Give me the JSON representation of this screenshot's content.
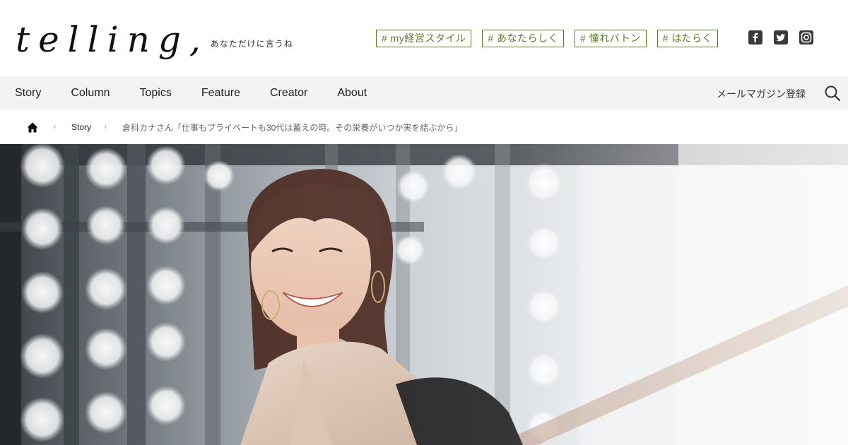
{
  "brand": {
    "logo": "telling,",
    "tagline": "あなただけに言うね"
  },
  "tags": [
    {
      "label": "# my経営スタイル"
    },
    {
      "label": "# あなたらしく"
    },
    {
      "label": "# 憧れバトン"
    },
    {
      "label": "# はたらく"
    }
  ],
  "social": [
    "facebook-icon",
    "twitter-icon",
    "instagram-icon"
  ],
  "nav": {
    "items": [
      {
        "label": "Story"
      },
      {
        "label": "Column"
      },
      {
        "label": "Topics"
      },
      {
        "label": "Feature"
      },
      {
        "label": "Creator"
      },
      {
        "label": "About"
      }
    ],
    "magazine": "メールマガジン登録",
    "search_icon": "search-icon"
  },
  "breadcrumb": {
    "home_icon": "home-icon",
    "section": "Story",
    "current": "倉科カナさん「仕事もプライベートも30代は蓄えの時。その栄養がいつか実を結ぶから」"
  },
  "hero": {
    "image": "woman smiling on staircase"
  },
  "colors": {
    "tag": "#5a7a2a",
    "nav_bg": "#f3f3f3",
    "social": "#3a3a3a"
  }
}
